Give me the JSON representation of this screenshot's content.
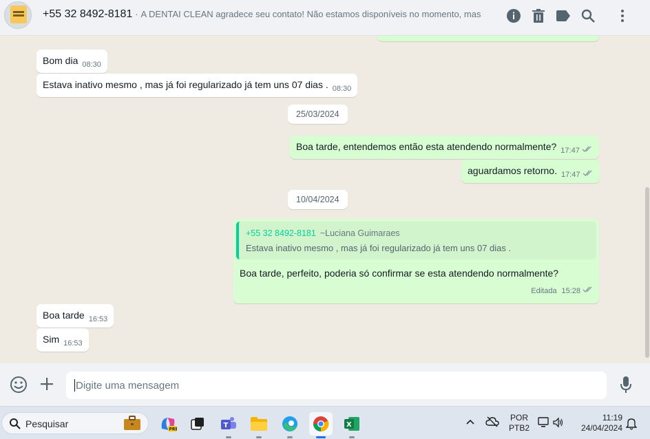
{
  "header": {
    "phone": "+55 32 8492-8181",
    "separator": "·",
    "status": "A DENTAI CLEAN agradece seu contato! Não estamos disponíveis no momento, mas ..."
  },
  "chat": {
    "messages": [
      {
        "text": "Bom dia",
        "time": "08:30"
      },
      {
        "text": "Estava inativo mesmo , mas já foi regularizado já tem uns 07 dias .",
        "time": "08:30"
      },
      {
        "date": "25/03/2024"
      },
      {
        "text": "Boa tarde, entendemos então esta atendendo normalmente?",
        "time": "17:47"
      },
      {
        "text": "aguardamos retorno.",
        "time": "17:47"
      },
      {
        "date": "10/04/2024"
      },
      {
        "quote_name": "+55 32 8492-8181",
        "quote_sub": "~Luciana Guimaraes",
        "quote_text": "Estava inativo mesmo , mas já foi regularizado já tem uns 07 dias .",
        "text": "Boa tarde, perfeito, poderia só confirmar se esta atendendo normalmente?",
        "edited": "Editada",
        "time": "15:28"
      },
      {
        "text": "Boa tarde",
        "time": "16:53"
      },
      {
        "text": "Sim",
        "time": "16:53"
      }
    ]
  },
  "composer": {
    "placeholder": "Digite uma mensagem"
  },
  "taskbar": {
    "search_label": "Pesquisar",
    "lang_top": "POR",
    "lang_bottom": "PTB2",
    "clock_time": "11:19",
    "clock_date": "24/04/2024"
  },
  "colors": {
    "incoming": "#ffffff",
    "outgoing": "#d9fdd3",
    "accent": "#06cf9c",
    "ticks": "#8696a0"
  },
  "icons": [
    "info-icon",
    "trash-icon",
    "label-icon",
    "search-icon",
    "more-icon",
    "emoji-icon",
    "plus-icon",
    "mic-icon"
  ]
}
